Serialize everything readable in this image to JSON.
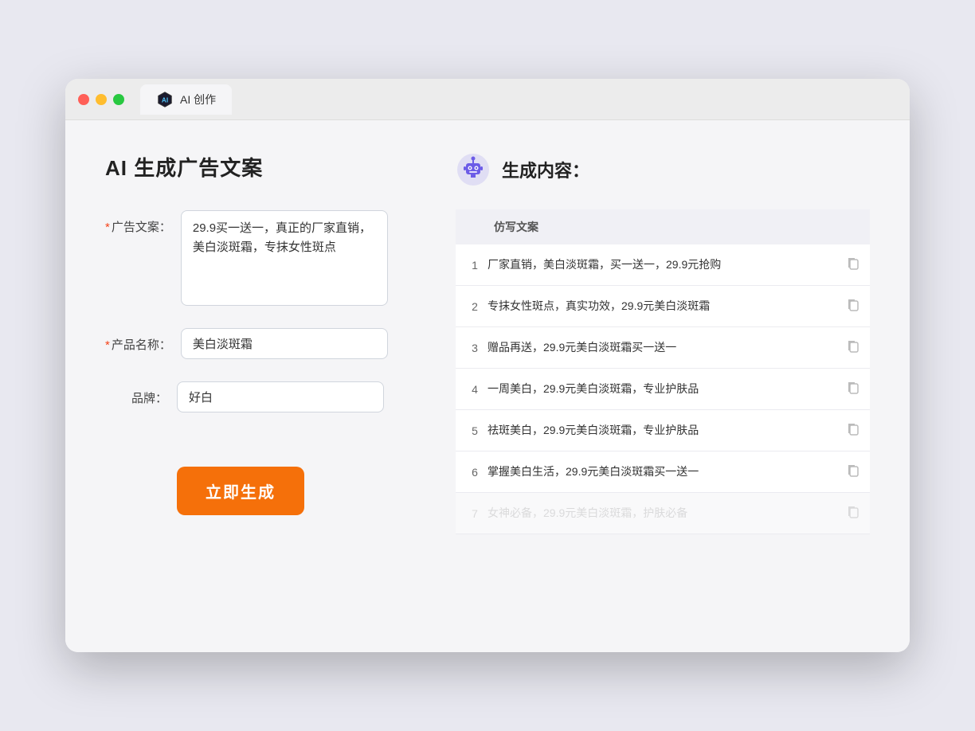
{
  "browser": {
    "tab_label": "AI 创作"
  },
  "left_panel": {
    "title": "AI 生成广告文案",
    "form": {
      "ad_copy_label": "广告文案：",
      "ad_copy_required": "*",
      "ad_copy_value": "29.9买一送一，真正的厂家直销，美白淡斑霜，专抹女性斑点",
      "product_name_label": "产品名称：",
      "product_name_required": "*",
      "product_name_value": "美白淡斑霜",
      "brand_label": "品牌：",
      "brand_value": "好白"
    },
    "generate_button": "立即生成"
  },
  "right_panel": {
    "title": "生成内容：",
    "table_header": "仿写文案",
    "results": [
      {
        "num": "1",
        "text": "厂家直销，美白淡斑霜，买一送一，29.9元抢购"
      },
      {
        "num": "2",
        "text": "专抹女性斑点，真实功效，29.9元美白淡斑霜"
      },
      {
        "num": "3",
        "text": "赠品再送，29.9元美白淡斑霜买一送一"
      },
      {
        "num": "4",
        "text": "一周美白，29.9元美白淡斑霜，专业护肤品"
      },
      {
        "num": "5",
        "text": "祛斑美白，29.9元美白淡斑霜，专业护肤品"
      },
      {
        "num": "6",
        "text": "掌握美白生活，29.9元美白淡斑霜买一送一"
      },
      {
        "num": "7",
        "text": "女神必备，29.9元美白淡斑霜，护肤必备",
        "faded": true
      }
    ]
  }
}
